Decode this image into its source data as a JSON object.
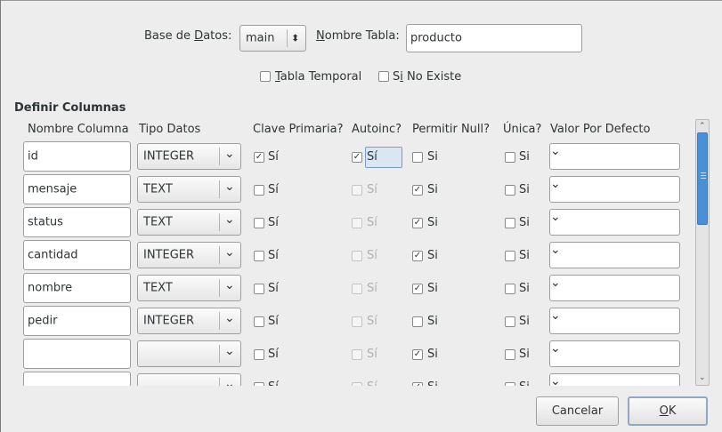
{
  "top": {
    "db_label_pre": "Base de ",
    "db_label_ul": "D",
    "db_label_post": "atos:",
    "db_value": "main",
    "table_label_ul": "N",
    "table_label_post": "ombre Tabla:",
    "table_value": "producto",
    "temp_ul": "T",
    "temp_post": "abla Temporal",
    "ifnot_pre": "S",
    "ifnot_ul": "i",
    "ifnot_post": " No Existe",
    "temp_checked": false,
    "ifnot_checked": false
  },
  "section_title": "Definir Columnas",
  "headers": {
    "name": "Nombre Columna",
    "type": "Tipo Datos",
    "pk": "Clave Primaria?",
    "ai": "Autoinc?",
    "nn": "Permitir Null?",
    "uq": "Única?",
    "def": "Valor Por Defecto"
  },
  "yes_pk": "Sí",
  "yes_ai": "Sí",
  "yes_null": "Si",
  "yes_uq": "Si",
  "rows": [
    {
      "name": "id",
      "type": "INTEGER",
      "pk": true,
      "ai": true,
      "ai_enabled": true,
      "null": false,
      "unique": false,
      "default": ""
    },
    {
      "name": "mensaje",
      "type": "TEXT",
      "pk": false,
      "ai": false,
      "ai_enabled": false,
      "null": true,
      "unique": false,
      "default": ""
    },
    {
      "name": "status",
      "type": "TEXT",
      "pk": false,
      "ai": false,
      "ai_enabled": false,
      "null": true,
      "unique": false,
      "default": ""
    },
    {
      "name": "cantidad",
      "type": "INTEGER",
      "pk": false,
      "ai": false,
      "ai_enabled": false,
      "null": true,
      "unique": false,
      "default": ""
    },
    {
      "name": "nombre",
      "type": "TEXT",
      "pk": false,
      "ai": false,
      "ai_enabled": false,
      "null": true,
      "unique": false,
      "default": ""
    },
    {
      "name": "pedir",
      "type": "INTEGER",
      "pk": false,
      "ai": false,
      "ai_enabled": false,
      "null": false,
      "unique": false,
      "default": ""
    },
    {
      "name": "",
      "type": "",
      "pk": false,
      "ai": false,
      "ai_enabled": false,
      "null": true,
      "unique": false,
      "default": ""
    },
    {
      "name": "",
      "type": "",
      "pk": false,
      "ai": false,
      "ai_enabled": false,
      "null": true,
      "unique": false,
      "default": ""
    }
  ],
  "buttons": {
    "cancel": "Cancelar",
    "ok_ul": "O",
    "ok_post": "K"
  },
  "icons": {
    "combo_arrow": "chevron-down-icon",
    "spin_arrows": "up-down-icon",
    "check": "check-icon"
  },
  "colors": {
    "background": "#ededed",
    "scroll_thumb": "#4a90d9",
    "focus": "#dbe6f3"
  }
}
